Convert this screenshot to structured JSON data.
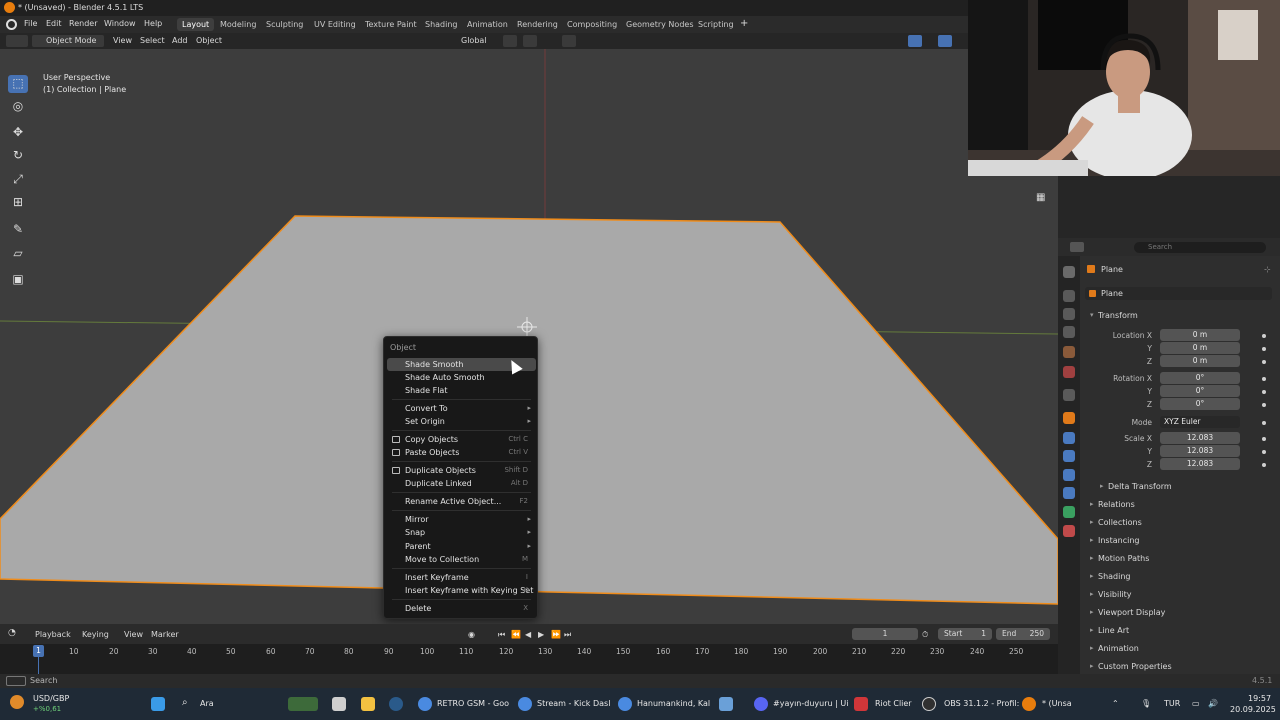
{
  "titlebar": {
    "title": "* (Unsaved) - Blender 4.5.1 LTS"
  },
  "menubar": {
    "menus": [
      "File",
      "Edit",
      "Render",
      "Window",
      "Help"
    ],
    "workspaces": [
      "Layout",
      "Modeling",
      "Sculpting",
      "UV Editing",
      "Texture Paint",
      "Shading",
      "Animation",
      "Rendering",
      "Compositing",
      "Geometry Nodes",
      "Scripting"
    ],
    "active_workspace": "Layout"
  },
  "viewport_header": {
    "mode": "Object Mode",
    "menus": [
      "View",
      "Select",
      "Add",
      "Object"
    ],
    "transform_orientation": "Global"
  },
  "viewport": {
    "perspective_label": "User Perspective",
    "collection_label": "(1) Collection | Plane"
  },
  "context_menu": {
    "title": "Object",
    "items": [
      {
        "label": "Shade Smooth",
        "shortcut": "",
        "submenu": false,
        "highlighted": true
      },
      {
        "label": "Shade Auto Smooth",
        "shortcut": "",
        "submenu": false
      },
      {
        "label": "Shade Flat",
        "shortcut": "",
        "submenu": false
      },
      {
        "label": "Convert To",
        "shortcut": "",
        "submenu": true
      },
      {
        "label": "Set Origin",
        "shortcut": "",
        "submenu": true
      },
      {
        "label": "Copy Objects",
        "shortcut": "Ctrl C",
        "submenu": false,
        "icon": true
      },
      {
        "label": "Paste Objects",
        "shortcut": "Ctrl V",
        "submenu": false,
        "icon": true
      },
      {
        "label": "Duplicate Objects",
        "shortcut": "Shift D",
        "submenu": false,
        "icon": true
      },
      {
        "label": "Duplicate Linked",
        "shortcut": "Alt D",
        "submenu": false
      },
      {
        "label": "Rename Active Object...",
        "shortcut": "F2",
        "submenu": false
      },
      {
        "label": "Mirror",
        "shortcut": "",
        "submenu": true
      },
      {
        "label": "Snap",
        "shortcut": "",
        "submenu": true
      },
      {
        "label": "Parent",
        "shortcut": "",
        "submenu": true
      },
      {
        "label": "Move to Collection",
        "shortcut": "M",
        "submenu": false
      },
      {
        "label": "Insert Keyframe",
        "shortcut": "I",
        "submenu": false
      },
      {
        "label": "Insert Keyframe with Keying Set",
        "shortcut": "K",
        "submenu": false
      },
      {
        "label": "Delete",
        "shortcut": "X",
        "submenu": false
      }
    ]
  },
  "properties": {
    "search_placeholder": "Search",
    "object_name": "Plane",
    "object_field": "Plane",
    "transform": {
      "header": "Transform",
      "location_label": "Location X",
      "location": [
        "0 m",
        "0 m",
        "0 m"
      ],
      "rotation_label": "Rotation X",
      "rotation": [
        "0°",
        "0°",
        "0°"
      ],
      "mode_label": "Mode",
      "mode_value": "XYZ Euler",
      "scale_label": "Scale X",
      "scale": [
        "12.083",
        "12.083",
        "12.083"
      ],
      "y_label": "Y",
      "z_label": "Z",
      "delta": "Delta Transform"
    },
    "panels": [
      "Relations",
      "Collections",
      "Instancing",
      "Motion Paths",
      "Shading",
      "Visibility",
      "Viewport Display",
      "Line Art",
      "Animation",
      "Custom Properties"
    ]
  },
  "timeline": {
    "menus": [
      "Playback",
      "Keying",
      "View",
      "Marker"
    ],
    "current_frame": "1",
    "start_label": "Start",
    "start": "1",
    "end_label": "End",
    "end": "250",
    "ruler_ticks": [
      "10",
      "20",
      "30",
      "40",
      "50",
      "60",
      "70",
      "80",
      "90",
      "100",
      "110",
      "120",
      "130",
      "140",
      "150",
      "160",
      "170",
      "180",
      "190",
      "200",
      "210",
      "220",
      "230",
      "240",
      "250"
    ],
    "playhead": "1"
  },
  "statusbar": {
    "left": "Search",
    "version": "4.5.1"
  },
  "taskbar": {
    "ticker_name": "USD/GBP",
    "ticker_change": "+%0,61",
    "search_label": "Ara",
    "apps": [
      "RETRO GSM - Goo",
      "Stream - Kick Dasl",
      "Hanumankind, Kal",
      "#yayın-duyuru | Ui",
      "Riot Clier",
      "OBS 31.1.2 - Profil:",
      "* (Unsa"
    ],
    "language": "TUR",
    "time": "19:57",
    "date": "20.09.2025"
  },
  "colors": {
    "viewport_bg": "#3d3d3d",
    "plane_fill": "#a9a9a9",
    "selection_outline": "#f08c1a",
    "active_blue": "#4772b3",
    "menu_bg": "#181818"
  }
}
